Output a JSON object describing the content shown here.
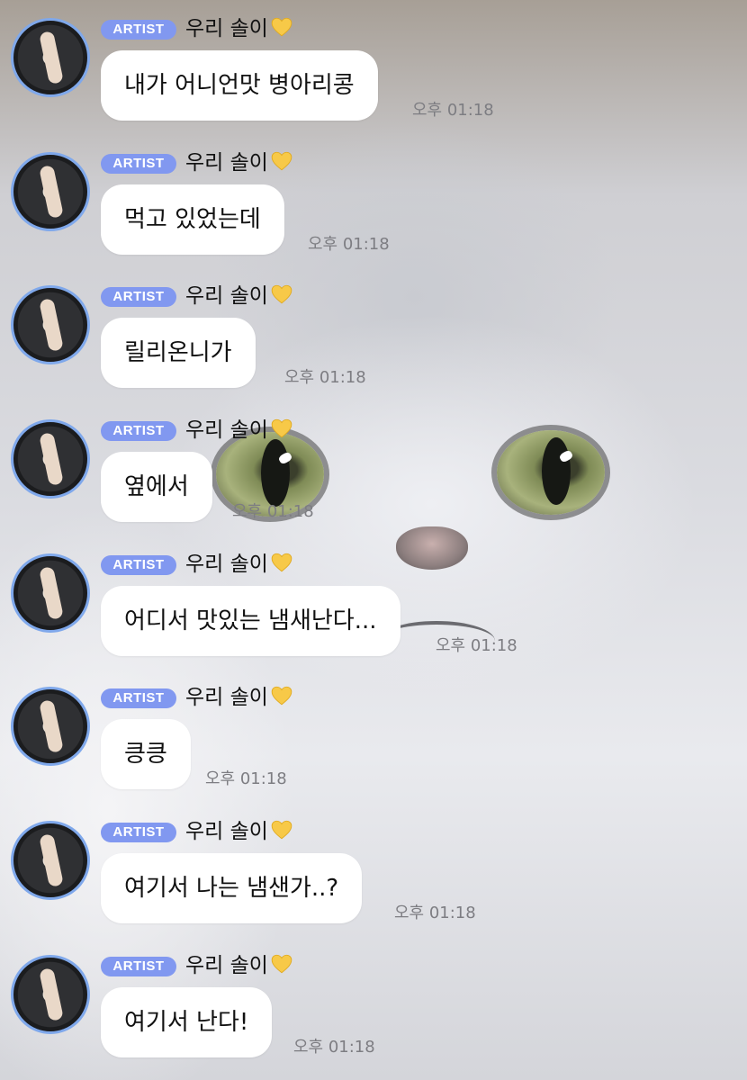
{
  "messages": [
    {
      "badge": "ARTIST",
      "sender": "우리 솔이",
      "text": "내가 어니언맛 병아리콩",
      "time": "오후 01:18"
    },
    {
      "badge": "ARTIST",
      "sender": "우리 솔이",
      "text": "먹고 있었는데",
      "time": "오후 01:18"
    },
    {
      "badge": "ARTIST",
      "sender": "우리 솔이",
      "text": "릴리온니가",
      "time": "오후 01:18"
    },
    {
      "badge": "ARTIST",
      "sender": "우리 솔이",
      "text": "옆에서",
      "time": "오후 01:18"
    },
    {
      "badge": "ARTIST",
      "sender": "우리 솔이",
      "text": "어디서 맛있는 냄새난다...",
      "time": "오후 01:18"
    },
    {
      "badge": "ARTIST",
      "sender": "우리 솔이",
      "text": "킁킁",
      "time": "오후 01:18"
    },
    {
      "badge": "ARTIST",
      "sender": "우리 솔이",
      "text": "여기서 나는 냄샌가..?",
      "time": "오후 01:18"
    },
    {
      "badge": "ARTIST",
      "sender": "우리 솔이",
      "text": "여기서 난다!",
      "time": "오후 01:18"
    }
  ],
  "colors": {
    "badge": "#8198f0",
    "avatar_ring": "#7fa8eb",
    "heart": "#f7c948",
    "bubble": "#ffffff",
    "timestamp": "#7d7d82"
  },
  "icons": {
    "sender_suffix": "yellow-heart-icon"
  }
}
